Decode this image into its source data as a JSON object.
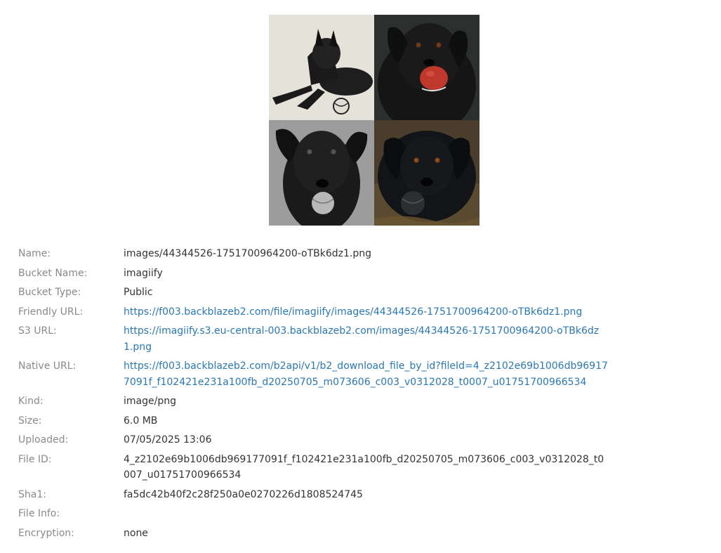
{
  "preview": {
    "tiles": [
      {
        "icon": "dog-sketch-image"
      },
      {
        "icon": "dog-red-ball-image"
      },
      {
        "icon": "dog-grayscale-ball-image"
      },
      {
        "icon": "dog-black-ball-image"
      }
    ]
  },
  "details": {
    "name": {
      "label": "Name:",
      "value": "images/44344526-1751700964200-oTBk6dz1.png"
    },
    "bucket_name": {
      "label": "Bucket Name:",
      "value": "imagiify"
    },
    "bucket_type": {
      "label": "Bucket Type:",
      "value": "Public"
    },
    "friendly_url": {
      "label": "Friendly URL:",
      "value": "https://f003.backblazeb2.com/file/imagiify/images/44344526-1751700964200-oTBk6dz1.png"
    },
    "s3_url": {
      "label": "S3 URL:",
      "value": "https://imagiify.s3.eu-central-003.backblazeb2.com/images/44344526-1751700964200-oTBk6dz1.png"
    },
    "native_url": {
      "label": "Native URL:",
      "value": "https://f003.backblazeb2.com/b2api/v1/b2_download_file_by_id?fileId=4_z2102e69b1006db969177091f_f102421e231a100fb_d20250705_m073606_c003_v0312028_t0007_u01751700966534"
    },
    "kind": {
      "label": "Kind:",
      "value": "image/png"
    },
    "size": {
      "label": "Size:",
      "value": "6.0 MB"
    },
    "uploaded": {
      "label": "Uploaded:",
      "value": "07/05/2025 13:06"
    },
    "file_id": {
      "label": "File ID:",
      "value": "4_z2102e69b1006db969177091f_f102421e231a100fb_d20250705_m073606_c003_v0312028_t0007_u01751700966534"
    },
    "sha1": {
      "label": "Sha1:",
      "value": "fa5dc42b40f2c28f250a0e0270226d1808524745"
    },
    "file_info": {
      "label": "File Info:",
      "value": ""
    },
    "encryption": {
      "label": "Encryption:",
      "value": "none"
    }
  },
  "colors": {
    "label": "#8a8a8a",
    "value": "#333333",
    "link": "#2a78b3"
  }
}
